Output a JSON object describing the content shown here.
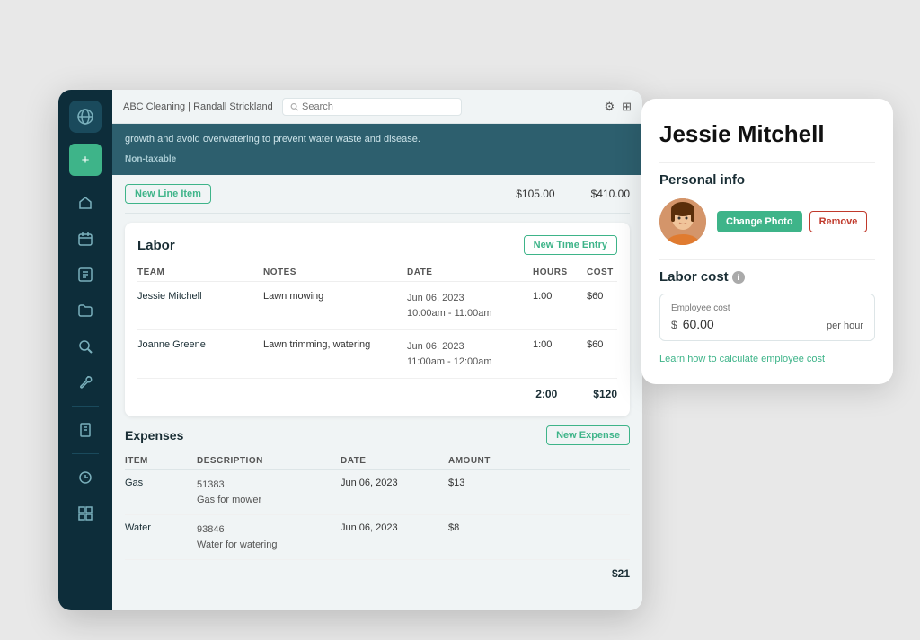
{
  "app": {
    "title": "ABC Cleaning | Randall Strickland",
    "search_placeholder": "Search"
  },
  "topbar": {
    "title": "ABC Cleaning | Randall Strickland",
    "search_placeholder": "Search"
  },
  "banner": {
    "description": "growth and avoid overwatering to prevent water waste and disease.",
    "label": "Non-taxable"
  },
  "line_item": {
    "button_label": "New Line Item",
    "amount1": "$105.00",
    "amount2": "$410.00"
  },
  "labor": {
    "title": "Labor",
    "new_time_button": "New Time Entry",
    "columns": {
      "team": "TEAM",
      "notes": "NOTES",
      "date": "DATE",
      "hours": "HOURS",
      "cost": "COST"
    },
    "rows": [
      {
        "name": "Jessie Mitchell",
        "notes": "Lawn mowing",
        "date": "Jun 06, 2023",
        "time": "10:00am - 11:00am",
        "hours": "1:00",
        "cost": "$60"
      },
      {
        "name": "Joanne Greene",
        "notes": "Lawn trimming, watering",
        "date": "Jun 06, 2023",
        "time": "11:00am - 12:00am",
        "hours": "1:00",
        "cost": "$60"
      }
    ],
    "total_hours": "2:00",
    "total_cost": "$120"
  },
  "expenses": {
    "title": "Expenses",
    "new_button": "New Expense",
    "columns": {
      "item": "ITEM",
      "description": "DESCRIPTION",
      "date": "DATE",
      "amount": "AMOUNT"
    },
    "rows": [
      {
        "item": "Gas",
        "desc_code": "51383",
        "desc_note": "Gas for mower",
        "date": "Jun 06, 2023",
        "amount": "$13"
      },
      {
        "item": "Water",
        "desc_code": "93846",
        "desc_note": "Water for watering",
        "date": "Jun 06, 2023",
        "amount": "$8"
      }
    ],
    "total": "$21"
  },
  "profile": {
    "name": "Jessie Mitchell",
    "section_personal": "Personal info",
    "change_photo_btn": "Change Photo",
    "remove_btn": "Remove",
    "labor_cost_title": "Labor cost",
    "employee_cost_label": "Employee cost",
    "employee_cost_symbol": "$",
    "employee_cost_value": "60.00",
    "per_hour_label": "per hour",
    "learn_link": "Learn how to calculate employee cost"
  },
  "sidebar": {
    "icons": [
      "🌐",
      "+",
      "🏠",
      "📅",
      "📋",
      "📁",
      "🔍",
      "🔧",
      "📄",
      "−",
      "🕐",
      "⚙️"
    ]
  }
}
